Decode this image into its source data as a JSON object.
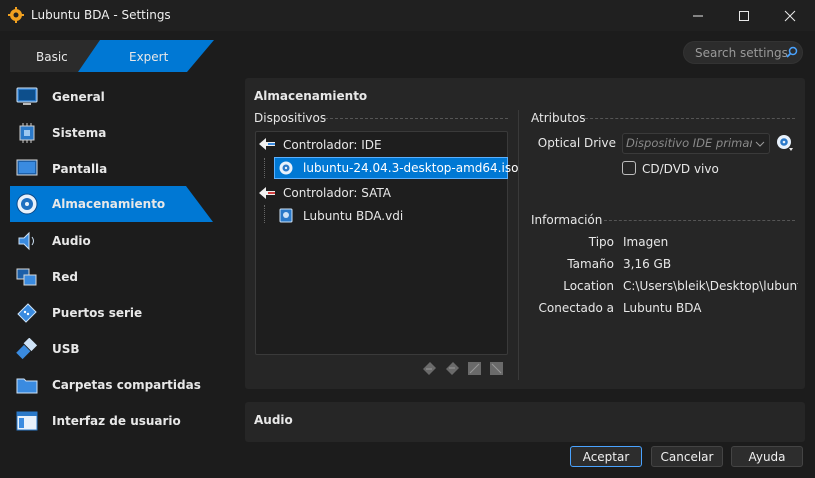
{
  "window": {
    "title": "Lubuntu BDA - Settings",
    "controls": [
      "minimize-icon",
      "maximize-icon",
      "close-icon"
    ]
  },
  "tabs": {
    "basic": "Basic",
    "expert": "Expert"
  },
  "search": {
    "placeholder": "Search settings"
  },
  "sidebar": {
    "items": [
      {
        "label": "General",
        "icon": "monitor-icon"
      },
      {
        "label": "Sistema",
        "icon": "chip-icon"
      },
      {
        "label": "Pantalla",
        "icon": "display-icon"
      },
      {
        "label": "Almacenamiento",
        "icon": "disk-icon",
        "selected": true
      },
      {
        "label": "Audio",
        "icon": "speaker-icon"
      },
      {
        "label": "Red",
        "icon": "network-icon"
      },
      {
        "label": "Puertos serie",
        "icon": "serial-port-icon"
      },
      {
        "label": "USB",
        "icon": "usb-icon"
      },
      {
        "label": "Carpetas compartidas",
        "icon": "folder-icon"
      },
      {
        "label": "Interfaz de usuario",
        "icon": "window-icon"
      }
    ]
  },
  "storage": {
    "heading": "Almacenamiento",
    "devices_title": "Dispositivos",
    "tree": [
      {
        "label": "Controlador: IDE",
        "type": "controller"
      },
      {
        "label": "lubuntu-24.04.3-desktop-amd64.iso",
        "type": "optical",
        "selected": true
      },
      {
        "label": "Controlador: SATA",
        "type": "controller"
      },
      {
        "label": "Lubuntu BDA.vdi",
        "type": "disk"
      }
    ],
    "attributes_title": "Atributos",
    "optical_drive_label": "Optical Drive",
    "optical_drive_value": "Dispositivo IDE primario",
    "live_cd_label": "CD/DVD vivo",
    "info_title": "Información",
    "info": [
      {
        "key": "Tipo",
        "value": "Imagen"
      },
      {
        "key": "Tamaño",
        "value": "3,16 GB"
      },
      {
        "key": "Location",
        "value": "C:\\Users\\bleik\\Desktop\\lubunt..."
      },
      {
        "key": "Conectado a",
        "value": "Lubuntu BDA"
      }
    ]
  },
  "audio": {
    "heading": "Audio"
  },
  "buttons": {
    "ok": "Aceptar",
    "cancel": "Cancelar",
    "help": "Ayuda"
  },
  "colors": {
    "accent": "#0078d4",
    "background": "#1c1c1c",
    "panel": "#262626"
  }
}
